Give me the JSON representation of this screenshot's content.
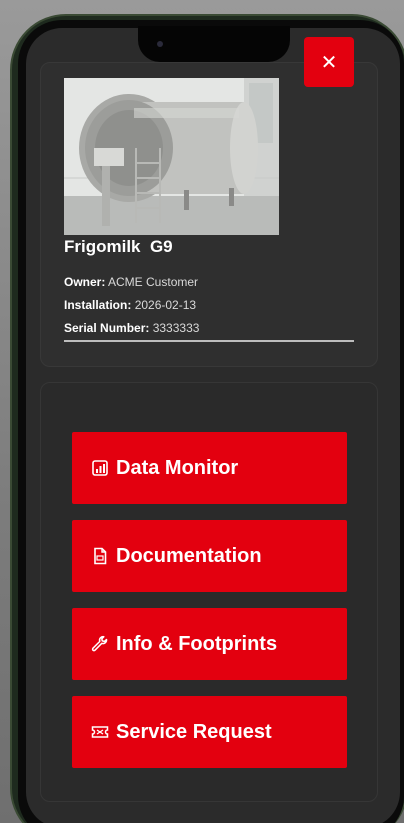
{
  "header": {
    "close_icon": "close-icon"
  },
  "machine": {
    "name": "Frigomilk  G9",
    "owner_label": "Owner:",
    "owner_value": "ACME Customer",
    "installation_label": "Installation:",
    "installation_value": "2026-02-13",
    "serial_label": "Serial Number:",
    "serial_value": "3333333"
  },
  "actions": [
    {
      "label": "Data Monitor",
      "icon": "chart-icon"
    },
    {
      "label": "Documentation",
      "icon": "pdf-document-icon"
    },
    {
      "label": "Info & Footprints",
      "icon": "wrench-icon"
    },
    {
      "label": "Service Request",
      "icon": "ticket-icon"
    }
  ],
  "colors": {
    "accent": "#e3000f",
    "card_background": "#2f2f2f",
    "screen_background": "#2b2b2b"
  }
}
